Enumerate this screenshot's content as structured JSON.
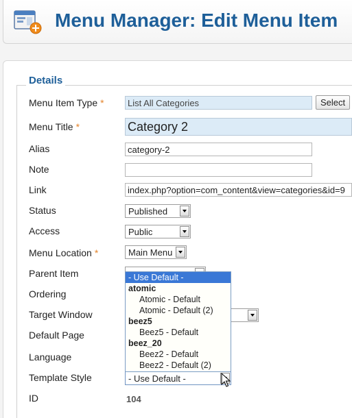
{
  "header": {
    "title": "Menu Manager: Edit Menu Item",
    "icon": "menu-manager-icon"
  },
  "details": {
    "legend": "Details",
    "fields": {
      "menu_item_type": {
        "label": "Menu Item Type",
        "value": "List All Categories",
        "button": "Select"
      },
      "menu_title": {
        "label": "Menu Title",
        "value": "Category 2"
      },
      "alias": {
        "label": "Alias",
        "value": "category-2"
      },
      "note": {
        "label": "Note",
        "value": ""
      },
      "link": {
        "label": "Link",
        "value": "index.php?option=com_content&view=categories&id=9"
      },
      "status": {
        "label": "Status",
        "value": "Published"
      },
      "access": {
        "label": "Access",
        "value": "Public"
      },
      "menu_location": {
        "label": "Menu Location",
        "value": "Main Menu"
      },
      "parent_item": {
        "label": "Parent Item"
      },
      "ordering": {
        "label": "Ordering"
      },
      "target_window": {
        "label": "Target Window"
      },
      "default_page": {
        "label": "Default Page"
      },
      "language": {
        "label": "Language"
      },
      "template_style": {
        "label": "Template Style",
        "value": "- Use Default -"
      },
      "id": {
        "label": "ID",
        "value": "104"
      }
    },
    "required_marker": "*"
  },
  "template_dropdown": {
    "options": [
      {
        "text": "- Use Default -",
        "kind": "selected"
      },
      {
        "text": "atomic",
        "kind": "group"
      },
      {
        "text": "Atomic - Default",
        "kind": "child"
      },
      {
        "text": "Atomic - Default (2)",
        "kind": "child"
      },
      {
        "text": "beez5",
        "kind": "group"
      },
      {
        "text": "Beez5 - Default",
        "kind": "child"
      },
      {
        "text": "beez_20",
        "kind": "group"
      },
      {
        "text": "Beez2 - Default",
        "kind": "child"
      },
      {
        "text": "Beez2 - Default (2)",
        "kind": "child"
      }
    ]
  },
  "colors": {
    "accent": "#1e5f99",
    "required": "#e4842c",
    "selected": "#3a78d6",
    "readonly_bg": "#dcebf7"
  }
}
